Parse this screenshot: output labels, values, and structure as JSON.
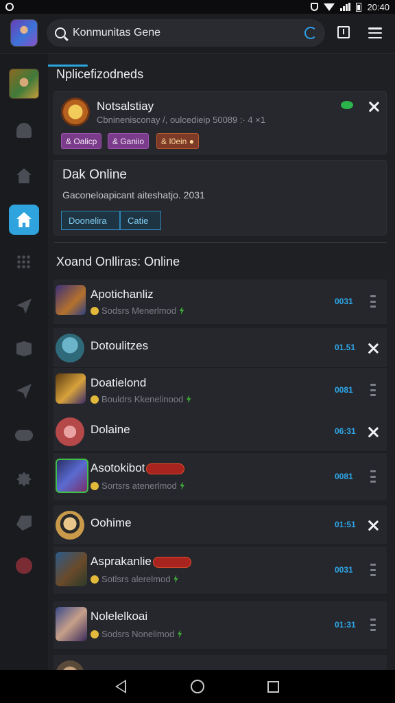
{
  "status_bar": {
    "time": "20:40"
  },
  "search": {
    "placeholder": "Konmunitas Gene"
  },
  "sections": {
    "notifications_title": "Nplicefizodneds",
    "online_title": "Xoand Onlliras: Online"
  },
  "notification": {
    "name": "Notsalstiay",
    "subtitle": "Cbninenisconay /, oulcedieip 50089 :· 4 ×1",
    "tags": [
      "& Oalicp",
      "& Ganiio",
      "& I0ein ●"
    ]
  },
  "dak_card": {
    "title": "Dak Online",
    "subtitle": "Gaconeloapicant aiteshatjo. 2031",
    "buttons": [
      "Doonelira",
      "Catie"
    ]
  },
  "friends": [
    {
      "name": "Apotichanliz",
      "sub": "Sodsrs Menerlmod",
      "time": "0031",
      "action": "more"
    },
    {
      "name": "Dotoulitzes",
      "sub": "",
      "time": "01.51",
      "action": "close"
    },
    {
      "name": "Doatielond",
      "sub": "Bouldrs Kkenelinood",
      "time": "0081",
      "action": "more"
    },
    {
      "name": "Dolaine",
      "sub": "",
      "time": "06:31",
      "action": "close"
    },
    {
      "name": "Asotokibot",
      "sub": "Sortsrs atenerlmod",
      "time": "0081",
      "action": "more"
    },
    {
      "name": "Oohime",
      "sub": "",
      "time": "01:51",
      "action": "close"
    },
    {
      "name": "Asprakanlie",
      "sub": "Sotlsrs alerelmod",
      "time": "0031",
      "action": "more"
    },
    {
      "name": "Nolelelkoai",
      "sub": "Sodsrs Nonelimod",
      "time": "01:31",
      "action": "more"
    }
  ],
  "colors": {
    "accent": "#2fa3dd",
    "online_green": "#2bb44b",
    "background": "#1f2024"
  }
}
